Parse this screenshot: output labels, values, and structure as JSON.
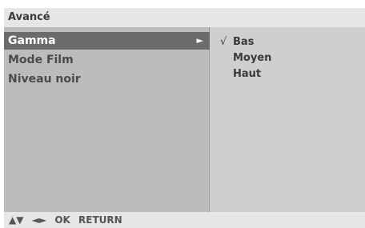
{
  "menu": {
    "title": "Avancé",
    "items": [
      {
        "label": "Gamma",
        "selected": true,
        "arrow": "►"
      },
      {
        "label": "Mode Film",
        "selected": false
      },
      {
        "label": "Niveau noir",
        "selected": false
      }
    ]
  },
  "submenu": {
    "options": [
      {
        "label": "Bas",
        "checked": true,
        "check": "√"
      },
      {
        "label": "Moyen",
        "checked": false
      },
      {
        "label": "Haut",
        "checked": false
      }
    ]
  },
  "footer": {
    "updown": "▲▼",
    "leftright": "◄►",
    "ok": "OK",
    "return": "RETURN"
  },
  "colors": {
    "title_bg": "#e6e6e6",
    "left_panel_bg": "#bcbcbc",
    "right_panel_bg": "#cfcfcf",
    "selected_bg": "#6b6b6b"
  }
}
